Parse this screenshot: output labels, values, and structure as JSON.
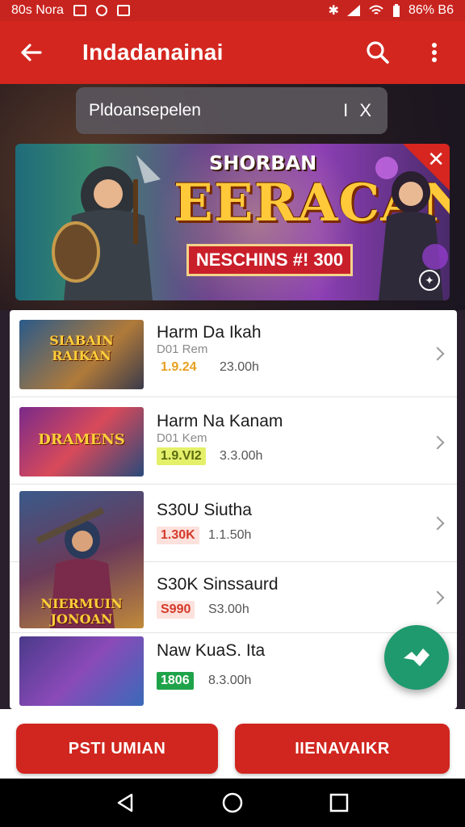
{
  "status_bar": {
    "left_text": "80s Nora",
    "right_text": "86% B6"
  },
  "app_bar": {
    "title": "Indadanainai"
  },
  "search": {
    "value": "Pldoansepelen",
    "clear_label": "I X"
  },
  "banner": {
    "kicker": "SHORBAN",
    "title": "EERACAN",
    "ribbon": "NESCHINS #! 300"
  },
  "list": {
    "items": [
      {
        "title": "Harm Da Ikah",
        "subtitle": "D01 Rem",
        "price": "1.9.24",
        "duration": "23.00h",
        "price_color": "#e8a020",
        "price_bg": "#ffffff",
        "thumb_label": "SIABAIN RAIKAN"
      },
      {
        "title": "Harm Na Kanam",
        "subtitle": "D01 Kem",
        "price": "1.9.VI2",
        "duration": "3.3.00h",
        "price_color": "#5a6a10",
        "price_bg": "#e4f06a",
        "thumb_label": "DRAMENS"
      },
      {
        "title": "S30U Siutha",
        "subtitle": "",
        "price": "1.30K",
        "duration": "1.1.50h",
        "price_color": "#d43a2a",
        "price_bg": "#fde1dc",
        "thumb_label": ""
      },
      {
        "title": "S30K Sinssaurd",
        "subtitle": "",
        "price": "S990",
        "duration": "S3.00h",
        "price_color": "#d43a2a",
        "price_bg": "#fde1dc",
        "thumb_label": "NIERMUIN JONOAN"
      },
      {
        "title": "Naw KuaS. Ita",
        "subtitle": "",
        "price": "1806",
        "duration": "8.3.00h",
        "price_color": "#ffffff",
        "price_bg": "#1fa34a",
        "thumb_label": ""
      }
    ]
  },
  "buttons": {
    "left": "PSTI UMIAN",
    "right": "IIENAVAIKR"
  }
}
